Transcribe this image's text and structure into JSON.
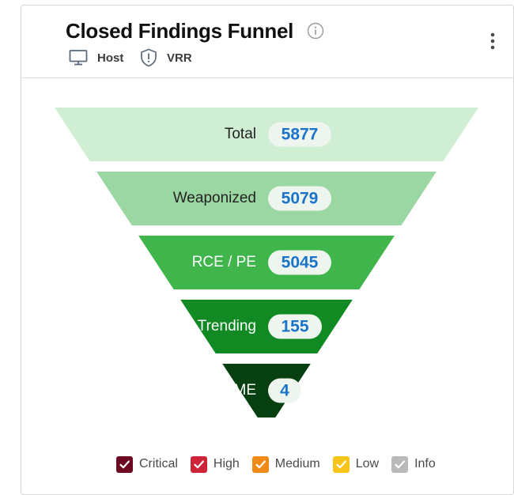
{
  "header": {
    "title": "Closed Findings Funnel",
    "tags": [
      {
        "label": "Host",
        "icon": "monitor-icon"
      },
      {
        "label": "VRR",
        "icon": "shield-alert-icon"
      }
    ]
  },
  "chart_data": {
    "type": "funnel",
    "title": "Closed Findings Funnel",
    "categories": [
      "Total",
      "Weaponized",
      "RCE / PE",
      "Trending",
      "ME"
    ],
    "values": [
      5877,
      5079,
      5045,
      155,
      4
    ],
    "stage_colors": [
      "#cfeed3",
      "#9bd7a2",
      "#3fb54c",
      "#118a24",
      "#063f10"
    ],
    "label_colors": [
      "#222222",
      "#222222",
      "#ffffff",
      "#ffffff",
      "#ffffff"
    ],
    "legend": [
      {
        "label": "Critical",
        "color": "#6d0a22"
      },
      {
        "label": "High",
        "color": "#cf2438"
      },
      {
        "label": "Medium",
        "color": "#f08a16"
      },
      {
        "label": "Low",
        "color": "#f7c51a"
      },
      {
        "label": "Info",
        "color": "#b9b9b9"
      }
    ]
  }
}
